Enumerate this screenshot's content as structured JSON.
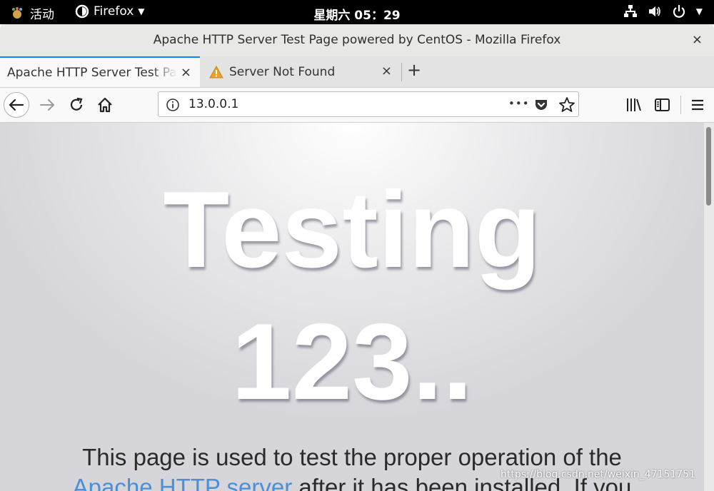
{
  "topbar": {
    "activities": "活动",
    "app_menu": "Firefox",
    "clock": "星期六 05：29"
  },
  "window": {
    "title": "Apache HTTP Server Test Page powered by CentOS - Mozilla Firefox",
    "close_glyph": "×"
  },
  "tabs": [
    {
      "label": "Apache HTTP Server Test Page powered by CentOS",
      "close": "×"
    },
    {
      "label": "Server Not Found",
      "close": "×"
    }
  ],
  "newtab": "+",
  "urlbar": {
    "url": "13.0.0.1",
    "more": "•••"
  },
  "page": {
    "headline1": "Testing",
    "headline2": "123..",
    "para_line1": "This page is used to test the proper operation of the",
    "para_link": "Apache HTTP server",
    "para_line2_rest": " after it has been installed. If you"
  },
  "watermark": "https://blog.csdn.net/weixin_47151751",
  "colors": {
    "tab_highlight": "#0a84ff",
    "link": "#4a90d9",
    "warning_icon": "#e8a12a"
  }
}
